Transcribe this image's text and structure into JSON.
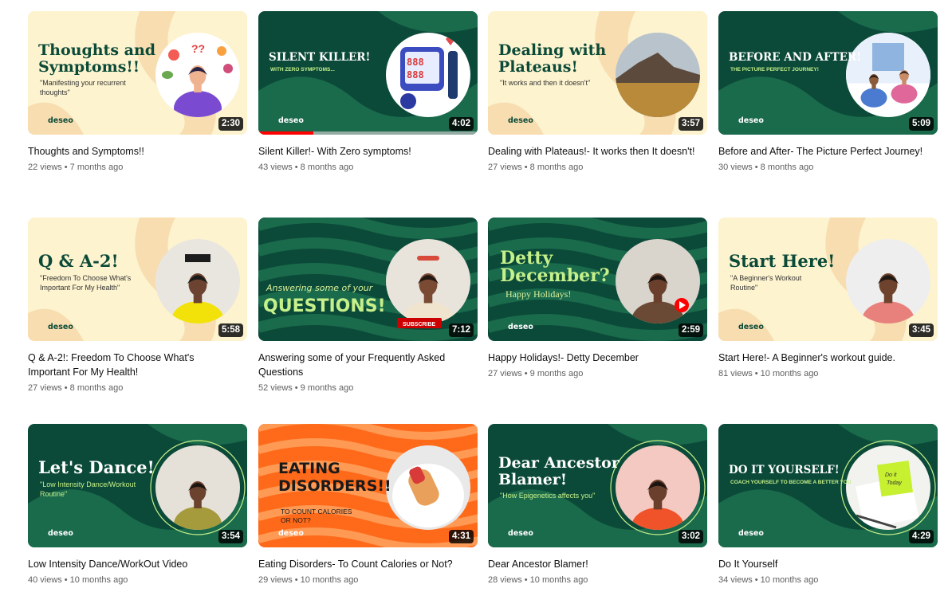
{
  "videos": [
    {
      "title": "Thoughts and Symptoms!!",
      "views": "22 views",
      "age": "7 months ago",
      "duration": "2:30",
      "thumb": {
        "theme": "cream",
        "headline": [
          "Thoughts and",
          "Symptoms!!"
        ],
        "sub": [
          "\"Manifesting your recurrent",
          "thoughts\""
        ],
        "logo": "deseo",
        "art": "woman-food"
      }
    },
    {
      "title": "Silent Killer!- With Zero symptoms!",
      "views": "43 views",
      "age": "8 months ago",
      "duration": "4:02",
      "progress": 0.25,
      "thumb": {
        "theme": "green",
        "headline": [
          "SILENT KILLER!"
        ],
        "sub": [
          "WITH ZERO SYMPTOMS..."
        ],
        "logo": "deseo",
        "art": "blood-pressure"
      }
    },
    {
      "title": "Dealing with Plateaus!- It works then It doesn't!",
      "views": "27 views",
      "age": "8 months ago",
      "duration": "3:57",
      "thumb": {
        "theme": "cream",
        "headline": [
          "Dealing with",
          "Plateaus!"
        ],
        "sub": [
          "\"It works and then it doesn't\""
        ],
        "logo": "deseo",
        "art": "mountain"
      }
    },
    {
      "title": "Before and After- The Picture Perfect Journey!",
      "views": "30 views",
      "age": "8 months ago",
      "duration": "5:09",
      "thumb": {
        "theme": "green",
        "headline": [
          "BEFORE AND AFTER!"
        ],
        "sub": [
          "THE PICTURE PERFECT JOURNEY!"
        ],
        "logo": "deseo",
        "art": "workout"
      }
    },
    {
      "title": "Q & A-2!: Freedom To Choose What's Important For My Health!",
      "views": "27 views",
      "age": "8 months ago",
      "duration": "5:58",
      "thumb": {
        "theme": "cream",
        "headline": [
          "Q & A-2!"
        ],
        "sub": [
          "\"Freedom To Choose What's",
          "Important For My Health\""
        ],
        "logo": "deseo",
        "art": "person-yellow"
      }
    },
    {
      "title": "Answering some of your Frequently Asked Questions",
      "views": "52 views",
      "age": "9 months ago",
      "duration": "7:12",
      "thumb": {
        "theme": "wave-green",
        "headline": [
          "QUESTIONS!"
        ],
        "sub": [
          "Answering some of your"
        ],
        "logo": "",
        "art": "person-headband",
        "badge": "SUBSCRIBE"
      }
    },
    {
      "title": "Happy Holidays!- Detty December",
      "views": "27 views",
      "age": "9 months ago",
      "duration": "2:59",
      "thumb": {
        "theme": "wave-green",
        "headline": [
          "Detty",
          "December?"
        ],
        "sub": [
          "Happy Holidays!"
        ],
        "logo": "deseo",
        "art": "person-smile"
      }
    },
    {
      "title": "Start Here!- A Beginner's workout guide.",
      "views": "81 views",
      "age": "10 months ago",
      "duration": "3:45",
      "thumb": {
        "theme": "cream",
        "headline": [
          "Start Here!"
        ],
        "sub": [
          "\"A Beginner's Workout",
          "Routine\""
        ],
        "logo": "deseo",
        "art": "person-pink"
      }
    },
    {
      "title": "Low Intensity Dance/WorkOut Video",
      "views": "40 views",
      "age": "10 months ago",
      "duration": "3:54",
      "thumb": {
        "theme": "green",
        "headline": [
          "Let's Dance!"
        ],
        "sub": [
          "\"Low Intensity Dance/Workout",
          "Routine\""
        ],
        "logo": "deseo",
        "art": "person-dance"
      }
    },
    {
      "title": "Eating Disorders- To Count Calories or Not?",
      "views": "29 views",
      "age": "10 months ago",
      "duration": "4:31",
      "thumb": {
        "theme": "orange",
        "headline": [
          "EATING",
          "DISORDERS!!"
        ],
        "sub": [
          "TO COUNT CALORIES",
          "OR NOT?"
        ],
        "logo": "deseo",
        "art": "food-plate"
      }
    },
    {
      "title": "Dear Ancestor Blamer!",
      "views": "28 views",
      "age": "10 months ago",
      "duration": "3:02",
      "thumb": {
        "theme": "green",
        "headline": [
          "Dear Ancestor",
          "Blamer!"
        ],
        "sub": [
          "\"How Epigenetics affects you\""
        ],
        "logo": "deseo",
        "art": "person-orange"
      }
    },
    {
      "title": "Do It Yourself",
      "views": "34 views",
      "age": "10 months ago",
      "duration": "4:29",
      "thumb": {
        "theme": "green",
        "headline": [
          "DO IT YOURSELF!"
        ],
        "sub": [
          "COACH YOURSELF TO BECOME A BETTER YOU"
        ],
        "logo": "deseo",
        "art": "sticky-note",
        "note": [
          "Do it",
          "Today"
        ]
      }
    }
  ],
  "colors": {
    "cream": "#fdf3cf",
    "cream_swoosh": "#f7ddb0",
    "green": "#0b4a38",
    "green_swoosh": "#1a6a4c",
    "headline_green": "#0b4a38",
    "headline_light": "#c6f08a",
    "orange": "#ff6a1a",
    "orange_wave": "#ff9a55",
    "red": "#ff0000"
  }
}
